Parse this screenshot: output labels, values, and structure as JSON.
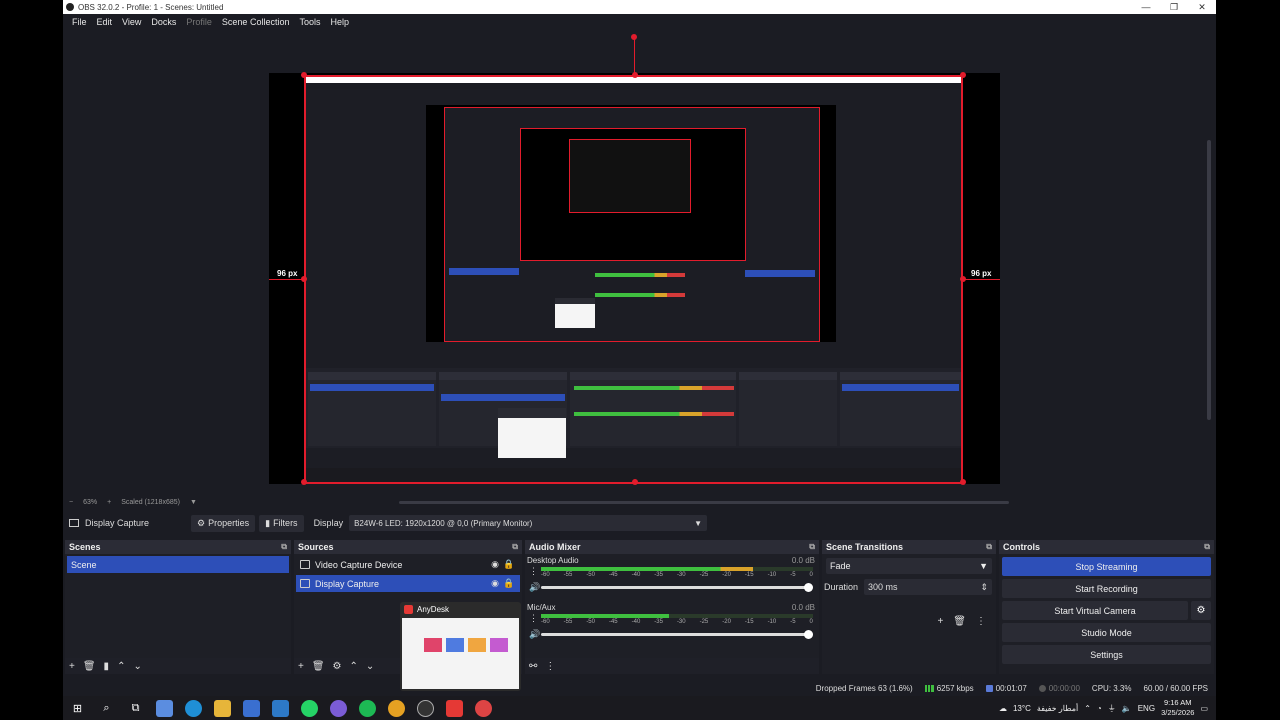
{
  "window": {
    "title": "OBS 32.0.2 - Profile: 1 - Scenes: Untitled",
    "controls": {
      "minimize": "—",
      "restore": "❐",
      "close": "✕"
    }
  },
  "menu": [
    "File",
    "Edit",
    "View",
    "Docks",
    "Profile",
    "Scene Collection",
    "Tools",
    "Help"
  ],
  "preview": {
    "left_px_label": "96 px",
    "right_px_label": "96 px",
    "zoom": "63%",
    "scale_mode": "Scaled (1218x685)"
  },
  "context_bar": {
    "source_name": "Display Capture",
    "properties_label": "Properties",
    "filters_label": "Filters",
    "display_label": "Display",
    "display_value": "B24W-6 LED: 1920x1200 @ 0,0 (Primary Monitor)"
  },
  "scenes": {
    "title": "Scenes",
    "items": [
      "Scene"
    ]
  },
  "sources": {
    "title": "Sources",
    "items": [
      "Video Capture Device",
      "Display Capture"
    ]
  },
  "audio_mixer": {
    "title": "Audio Mixer",
    "channels": [
      {
        "name": "Desktop Audio",
        "db": "0.0 dB",
        "level": 0.78
      },
      {
        "name": "Mic/Aux",
        "db": "0.0 dB",
        "level": 0.47
      }
    ],
    "scale": [
      "-60",
      "-55",
      "-50",
      "-45",
      "-40",
      "-35",
      "-30",
      "-25",
      "-20",
      "-15",
      "-10",
      "-5",
      "0"
    ]
  },
  "scene_transitions": {
    "title": "Scene Transitions",
    "transition": "Fade",
    "duration_label": "Duration",
    "duration_value": "300 ms"
  },
  "controls": {
    "title": "Controls",
    "stop_streaming": "Stop Streaming",
    "start_recording": "Start Recording",
    "start_virtual_camera": "Start Virtual Camera",
    "studio_mode": "Studio Mode",
    "settings": "Settings"
  },
  "popup": {
    "title": "AnyDesk"
  },
  "status": {
    "dropped_frames": "Dropped Frames 63 (1.6%)",
    "bitrate": "6257 kbps",
    "stream_time": "00:01:07",
    "rec_time": "00:00:00",
    "cpu": "CPU: 3.3%",
    "fps": "60.00 / 60.00 FPS"
  },
  "taskbar": {
    "weather": "13°C",
    "weather_text": "أمطار خفيفة",
    "language": "ENG",
    "time": "9:16 AM",
    "date": "3/25/2026"
  },
  "colors": {
    "accent": "#2d4fb8",
    "selection_red": "#e21c2c",
    "panel_bg": "#1f2028",
    "header_bg": "#2b2c36"
  }
}
